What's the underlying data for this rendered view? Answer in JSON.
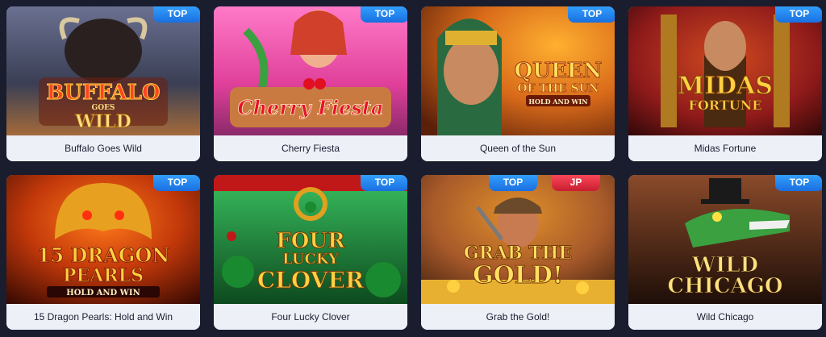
{
  "games": [
    {
      "name": "Buffalo Goes Wild",
      "badges": [
        "TOP"
      ],
      "art": [
        "BUFFALO",
        "GOES",
        "WILD"
      ],
      "colors": [
        "#3a3f55",
        "#a46a3a"
      ]
    },
    {
      "name": "Cherry Fiesta",
      "badges": [
        "TOP"
      ],
      "art": [
        "Cherry Fiesta"
      ],
      "colors": [
        "#f04aa8",
        "#8b2a6a"
      ]
    },
    {
      "name": "Queen of the Sun",
      "badges": [
        "TOP"
      ],
      "art": [
        "QUEEN",
        "OF THE SUN",
        "HOLD AND WIN"
      ],
      "colors": [
        "#d86a1a",
        "#7a2f10"
      ]
    },
    {
      "name": "Midas Fortune",
      "badges": [
        "TOP"
      ],
      "art": [
        "MIDAS",
        "FORTUNE"
      ],
      "colors": [
        "#8e1a1a",
        "#3d0a0a"
      ]
    },
    {
      "name": "15 Dragon Pearls: Hold and Win",
      "badges": [
        "TOP"
      ],
      "art": [
        "15 DRAGON",
        "PEARLS",
        "HOLD AND WIN"
      ],
      "colors": [
        "#c2380a",
        "#4a0e04"
      ]
    },
    {
      "name": "Four Lucky Clover",
      "badges": [
        "TOP"
      ],
      "art": [
        "FOUR",
        "LUCKY",
        "CLOVER"
      ],
      "colors": [
        "#2aa14a",
        "#0d4a1e"
      ]
    },
    {
      "name": "Grab the Gold!",
      "badges": [
        "TOP",
        "JP"
      ],
      "art": [
        "GRAB THE",
        "GOLD!"
      ],
      "colors": [
        "#a85a2a",
        "#3a1e10"
      ]
    },
    {
      "name": "Wild Chicago",
      "badges": [
        "TOP"
      ],
      "art": [
        "WILD",
        "CHICAGO"
      ],
      "colors": [
        "#5a2a1a",
        "#1e0e08"
      ]
    }
  ],
  "accent": {
    "top_badge": "#1a8cff",
    "jp_badge": "#e63346",
    "caption_bg": "#eef0f8",
    "page_bg": "#1a1d2e"
  }
}
